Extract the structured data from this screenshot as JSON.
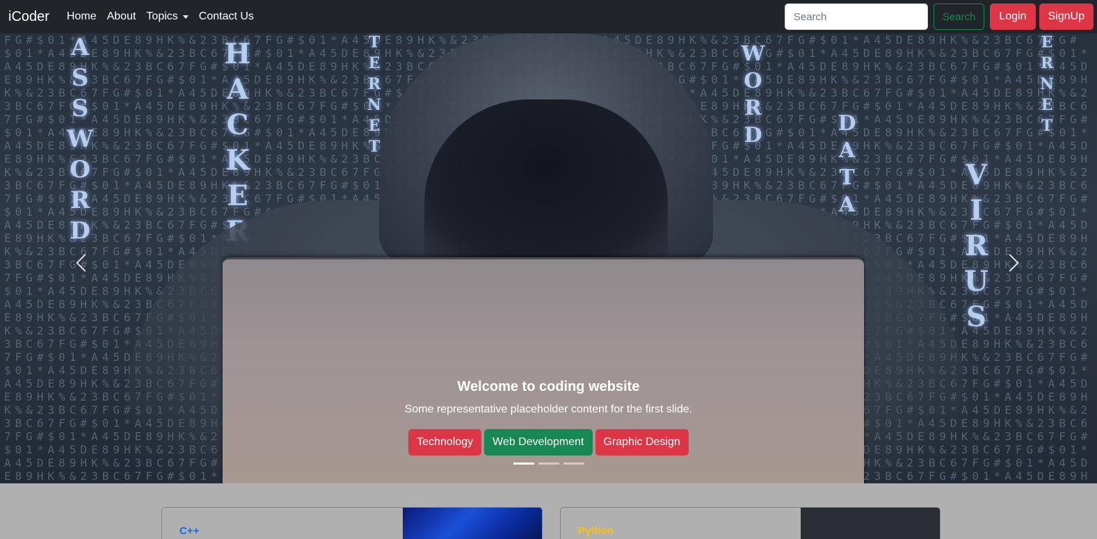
{
  "navbar": {
    "brand": "iCoder",
    "links": [
      "Home",
      "About",
      "Topics",
      "Contact Us"
    ],
    "search_placeholder": "Search",
    "search_button": "Search",
    "login_button": "Login",
    "signup_button": "SignUp"
  },
  "carousel": {
    "background_words": [
      "ASSWORD",
      "HACKER",
      "TERNET",
      "WORD",
      "DATA",
      "VIRUS",
      "ERNET"
    ],
    "slide": {
      "title": "Welcome to coding website",
      "text": "Some representative placeholder content for the first slide.",
      "buttons": [
        "Technology",
        "Web Development",
        "Graphic Design"
      ]
    },
    "indicators": 3,
    "active_indicator": 0
  },
  "cards": [
    {
      "category": "C++",
      "category_color": "#0d6efd"
    },
    {
      "category": "Python",
      "category_color": "#ffc107"
    }
  ],
  "colors": {
    "navbar_bg": "#212529",
    "danger": "#dc3545",
    "success": "#198754",
    "page_bg": "#b0b0b0"
  }
}
